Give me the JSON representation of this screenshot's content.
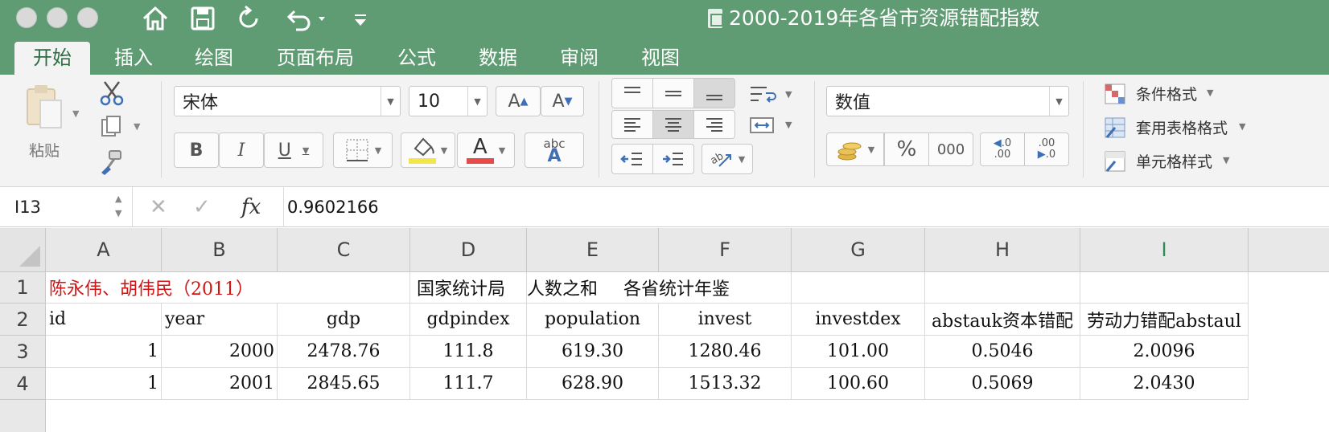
{
  "window": {
    "title": "2000-2019年各省市资源错配指数"
  },
  "ribbon_tabs": [
    "开始",
    "插入",
    "绘图",
    "页面布局",
    "公式",
    "数据",
    "审阅",
    "视图"
  ],
  "ribbon": {
    "paste_label": "粘贴",
    "font_name": "宋体",
    "font_size": "10",
    "bold": "B",
    "italic": "I",
    "underline": "U",
    "increase_font": "A",
    "decrease_font": "A",
    "font_color_letter": "A",
    "abc_label": "abc",
    "number_format": "数值",
    "percent": "%",
    "thousands": "000",
    "inc_decimal": ".00",
    "dec_decimal": ".00",
    "conditional_format": "条件格式",
    "table_format": "套用表格格式",
    "cell_styles": "单元格样式",
    "colors": {
      "fill_swatch": "#f2e64a",
      "font_swatch": "#e84a4a"
    }
  },
  "formula_bar": {
    "name_box": "I13",
    "fx": "fx",
    "value": "0.9602166"
  },
  "sheet": {
    "columns": [
      "A",
      "B",
      "C",
      "D",
      "E",
      "F",
      "G",
      "H",
      "I"
    ],
    "selected_column": "I",
    "row_numbers": [
      "1",
      "2",
      "3",
      "4"
    ],
    "row1": {
      "a": "陈永伟、胡伟民（2011）",
      "d": "国家统计局",
      "e": "人数之和",
      "f": "各省统计年鉴"
    },
    "headers": [
      "id",
      "year",
      "gdp",
      "gdpindex",
      "population",
      "invest",
      "investdex",
      "abstauk资本错配",
      "劳动力错配abstaul"
    ],
    "rows": [
      [
        "1",
        "2000",
        "2478.76",
        "111.8",
        "619.30",
        "1280.46",
        "101.00",
        "0.5046",
        "2.0096"
      ],
      [
        "1",
        "2001",
        "2845.65",
        "111.7",
        "628.90",
        "1513.32",
        "100.60",
        "0.5069",
        "2.0430"
      ]
    ]
  }
}
